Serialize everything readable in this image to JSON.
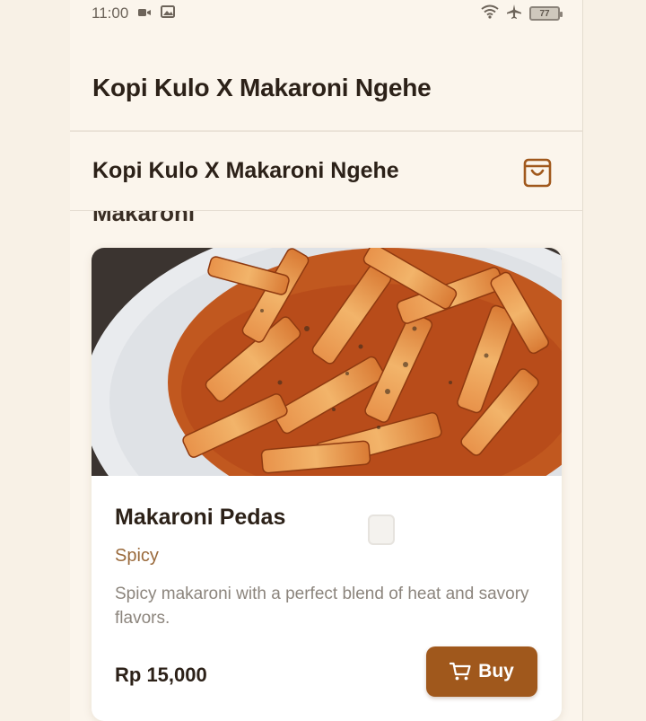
{
  "status_bar": {
    "time": "11:00",
    "battery": "77",
    "icons": [
      "video-icon",
      "gallery-icon",
      "wifi-icon",
      "airplane-icon",
      "battery-icon"
    ]
  },
  "appbar": {
    "title": "Kopi Kulo X Makaroni Ngehe"
  },
  "subheader": {
    "title": "Kopi Kulo X Makaroni Ngehe",
    "cart_icon": "shopping-bag-icon"
  },
  "section": {
    "title": "Makaroni"
  },
  "product": {
    "name": "Makaroni Pedas",
    "tag": "Spicy",
    "description": "Spicy makaroni with a perfect blend of heat and savory flavors.",
    "price": "Rp 15,000",
    "buy_label": "Buy",
    "buy_icon": "cart-icon"
  },
  "colors": {
    "background": "#fbf5ec",
    "accent": "#a0581c",
    "tag": "#9a6a3c",
    "text": "#2c2118"
  }
}
